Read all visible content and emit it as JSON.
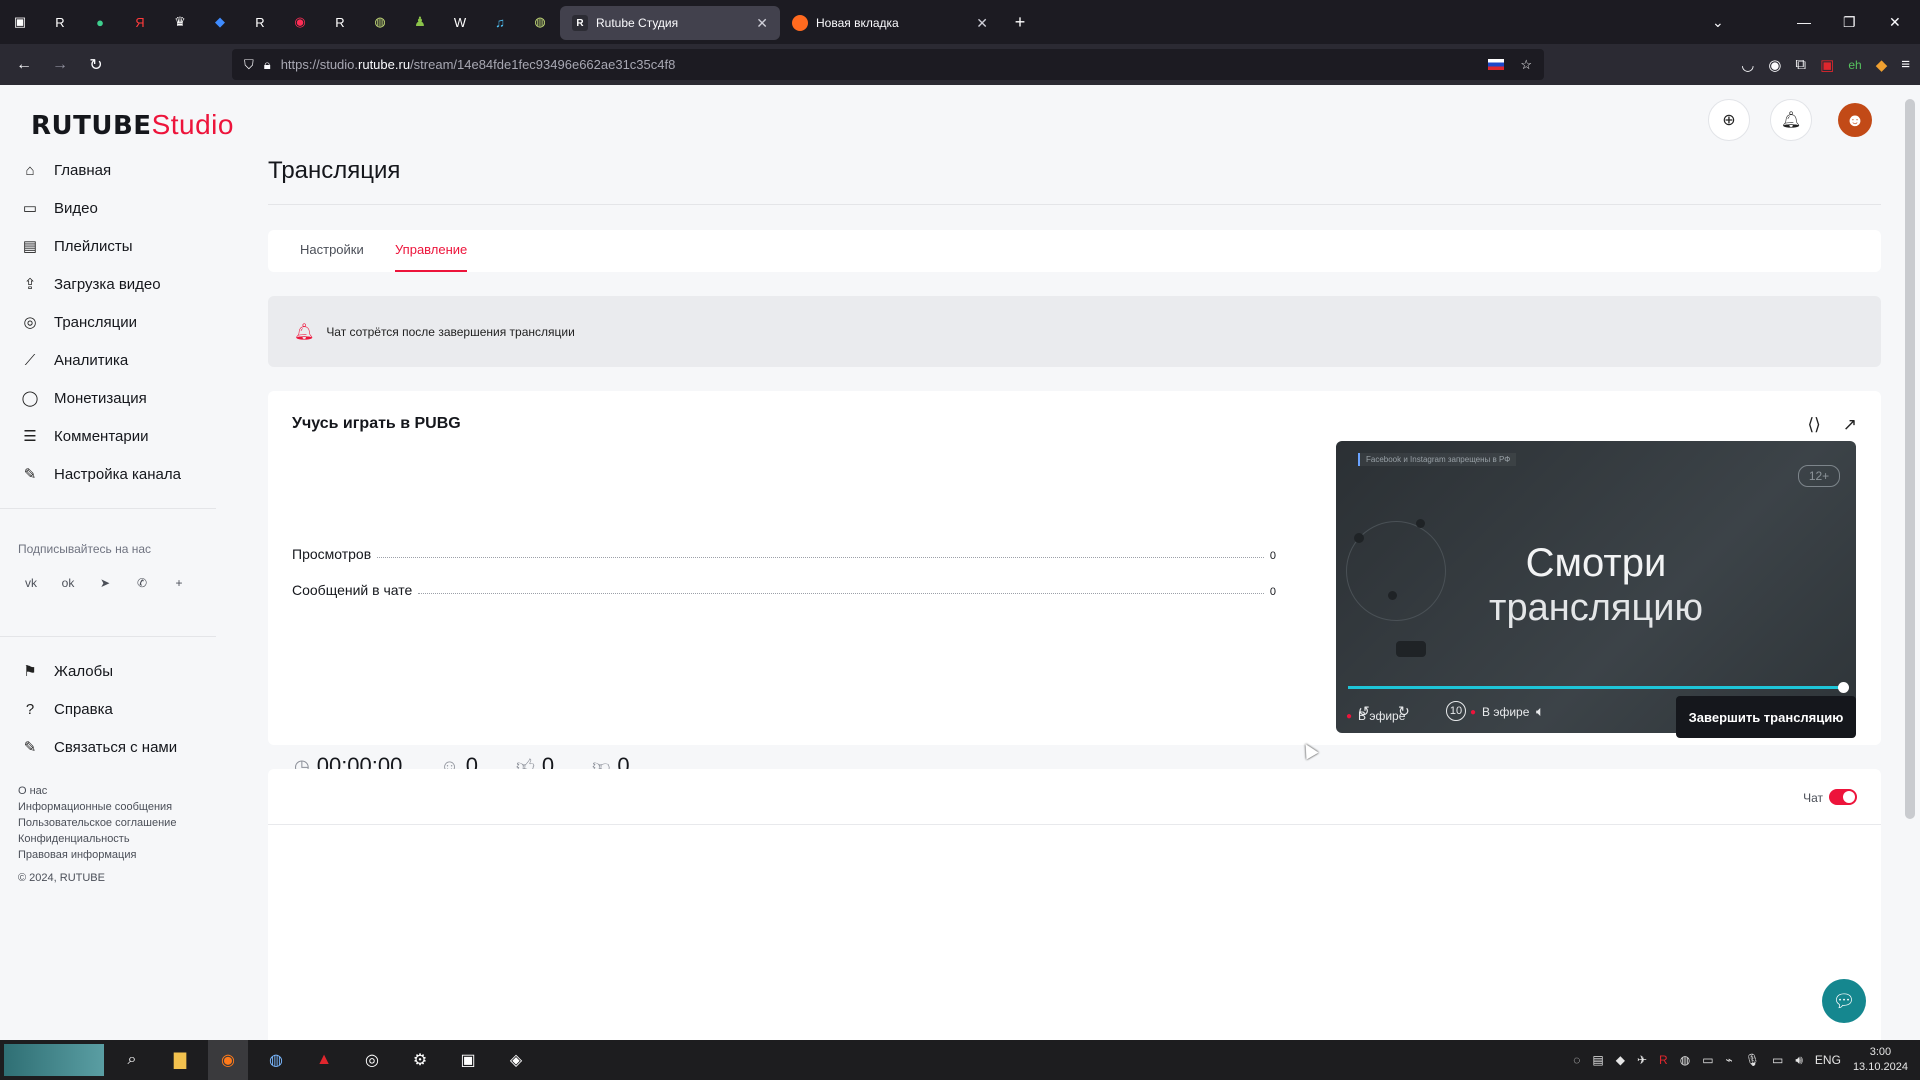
{
  "browser": {
    "tabs": [
      {
        "title": "Rutube Студия",
        "favicon": "R",
        "active": true
      },
      {
        "title": "Новая вкладка",
        "favicon": "firefox",
        "active": false
      }
    ],
    "new_tab_symbol": "+",
    "url_prefix": "https://studio.",
    "url_host": "rutube.ru",
    "url_path": "/stream/14e84fde1fec93496e662ae31c35c4f8",
    "pinned_icons": [
      "R",
      "●",
      "Я",
      "♛",
      "◆",
      "R",
      "◉",
      "R",
      "◍",
      "♟",
      "W",
      "♫",
      "◍"
    ]
  },
  "logo": {
    "main": "RUTUBE",
    "sub": "Studio"
  },
  "sidebar": {
    "items": [
      {
        "label": "Главная",
        "icon": "home-icon",
        "glyph": "⌂"
      },
      {
        "label": "Видео",
        "icon": "video-icon",
        "glyph": "▭"
      },
      {
        "label": "Плейлисты",
        "icon": "playlist-icon",
        "glyph": "▤"
      },
      {
        "label": "Загрузка видео",
        "icon": "upload-icon",
        "glyph": "⇪"
      },
      {
        "label": "Трансляции",
        "icon": "broadcast-icon",
        "glyph": "◎"
      },
      {
        "label": "Аналитика",
        "icon": "analytics-icon",
        "glyph": "⟋"
      },
      {
        "label": "Монетизация",
        "icon": "monetization-icon",
        "glyph": "◯"
      },
      {
        "label": "Комментарии",
        "icon": "comments-icon",
        "glyph": "☰"
      },
      {
        "label": "Настройка канала",
        "icon": "channel-settings-icon",
        "glyph": "✎"
      }
    ],
    "follow_label": "Подписывайтесь на нас",
    "socials": [
      {
        "name": "vk-icon",
        "glyph": "vk"
      },
      {
        "name": "ok-icon",
        "glyph": "ok"
      },
      {
        "name": "telegram-icon",
        "glyph": "➤"
      },
      {
        "name": "viber-icon",
        "glyph": "✆"
      },
      {
        "name": "more-icon",
        "glyph": "+"
      }
    ],
    "items2": [
      {
        "label": "Жалобы",
        "icon": "flag-icon",
        "glyph": "⚑"
      },
      {
        "label": "Справка",
        "icon": "help-icon",
        "glyph": "?"
      },
      {
        "label": "Связаться с нами",
        "icon": "contact-icon",
        "glyph": "✎"
      }
    ],
    "footer_links": [
      "О нас",
      "Информационные сообщения",
      "Пользовательское соглашение",
      "Конфиденциальность",
      "Правовая информация"
    ],
    "copyright": "© 2024, RUTUBE"
  },
  "page": {
    "title": "Трансляция",
    "tabs": [
      {
        "label": "Настройки"
      },
      {
        "label": "Управление"
      }
    ],
    "notice": "Чат сотрётся после завершения трансляции"
  },
  "stream": {
    "title": "Учусь играть в PUBG",
    "stats": [
      {
        "label": "Просмотров",
        "value": "0"
      },
      {
        "label": "Сообщений в чате",
        "value": "0"
      }
    ],
    "duration": "00:00:00",
    "viewers": "0",
    "likes": "0",
    "dislikes": "0",
    "end_button": "Завершить трансляцию"
  },
  "player": {
    "fb_note": "Facebook и Instagram запрещены в РФ",
    "age": "12+",
    "line1": "Смотри",
    "line2": "трансляцию",
    "live_label": "В эфире",
    "live_label2": "В эфире",
    "skip": "10",
    "accent": "#1ec5d8"
  },
  "chat": {
    "label": "Чат",
    "enabled": true
  },
  "taskbar": {
    "lang": "ENG",
    "time": "3:00",
    "date": "13.10.2024"
  },
  "colors": {
    "brand": "#ed143b",
    "dark": "#15171c"
  }
}
